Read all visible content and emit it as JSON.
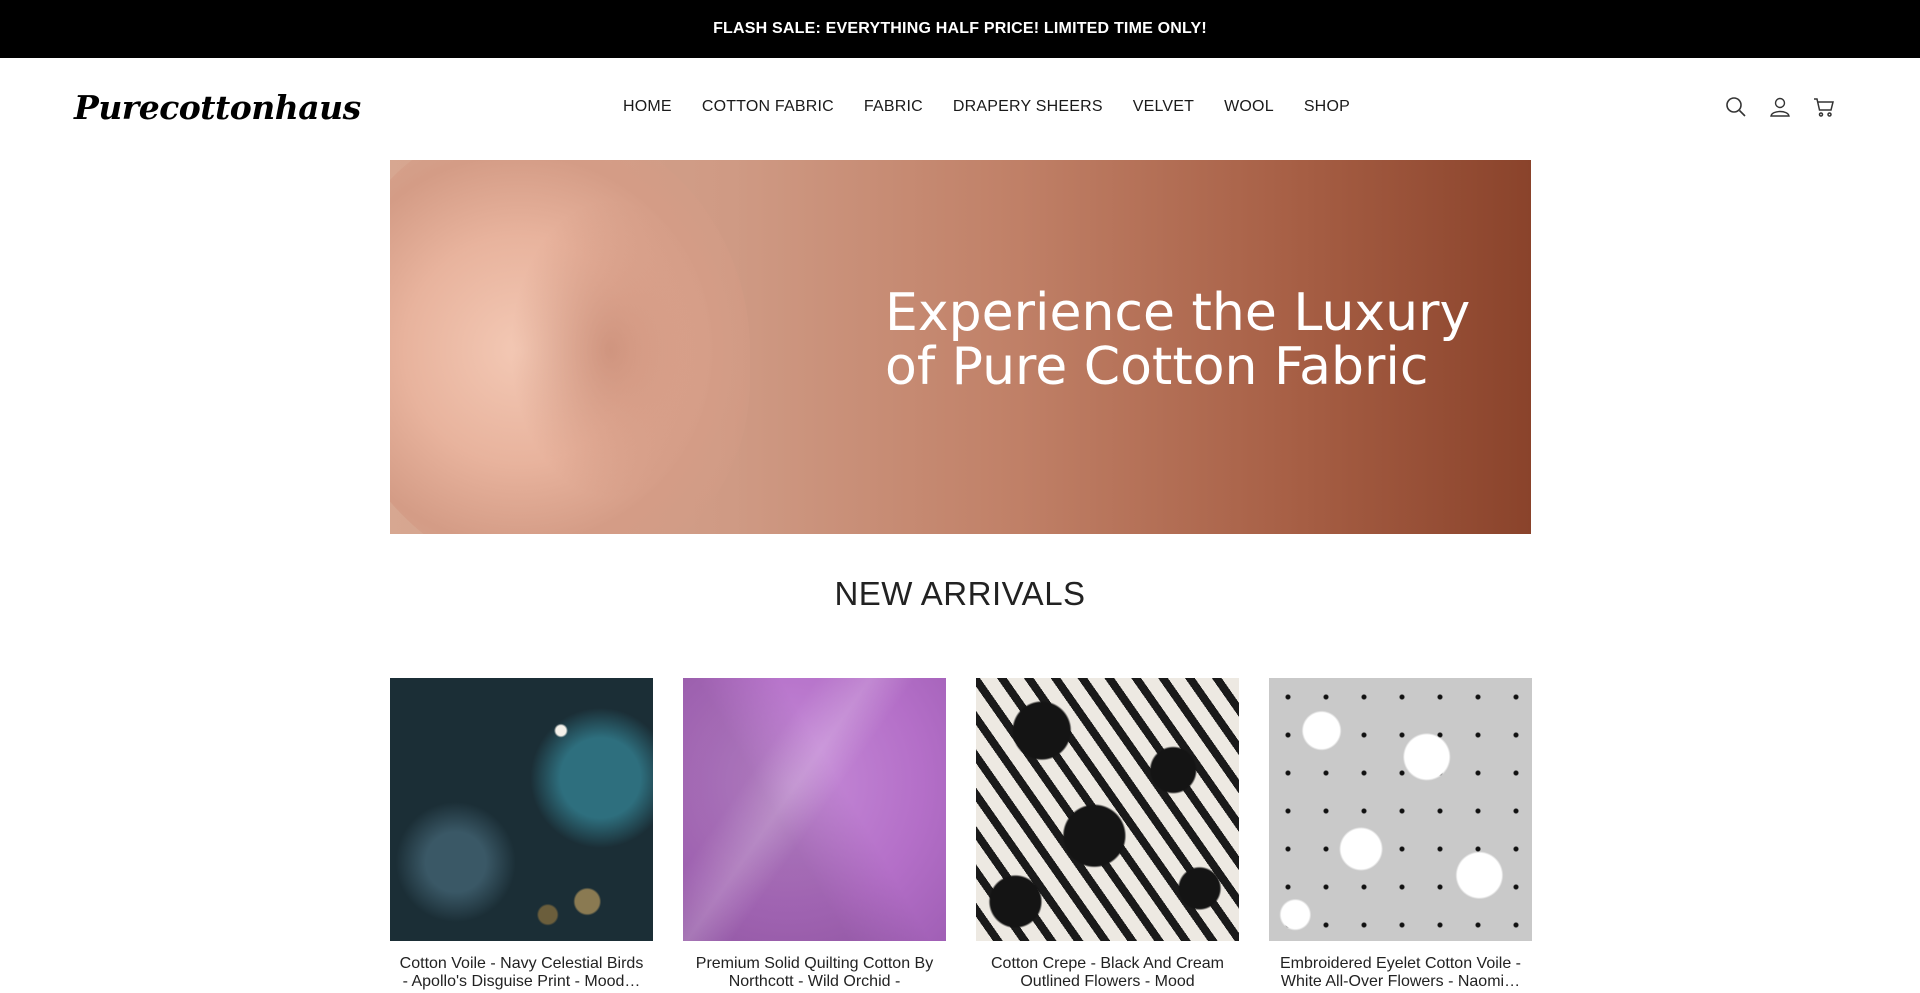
{
  "announcement": {
    "text": "FLASH SALE: EVERYTHING HALF PRICE! LIMITED TIME ONLY!"
  },
  "header": {
    "logo": "Purecottonhaus",
    "nav": [
      {
        "label": "HOME"
      },
      {
        "label": "COTTON FABRIC"
      },
      {
        "label": "FABRIC"
      },
      {
        "label": "DRAPERY SHEERS"
      },
      {
        "label": "VELVET"
      },
      {
        "label": "WOOL"
      },
      {
        "label": "SHOP"
      }
    ],
    "icons": [
      "search-icon",
      "account-icon",
      "cart-icon"
    ]
  },
  "hero": {
    "title": "Experience the Luxury of Pure Cotton Fabric"
  },
  "new_arrivals": {
    "title": "NEW ARRIVALS",
    "products": [
      {
        "name": "Cotton Voile - Navy Celestial Birds - Apollo's Disguise Print - Mood…"
      },
      {
        "name": "Premium Solid Quilting Cotton By Northcott - Wild Orchid - Colorwork…"
      },
      {
        "name": "Cotton Crepe - Black And Cream Outlined Flowers - Mood Exclusive…"
      },
      {
        "name": "Embroidered Eyelet Cotton Voile - White All-Over Flowers - Naomi…"
      }
    ]
  },
  "colors": {
    "announcement_bg": "#000000",
    "hero_dark": "#8a432b",
    "hero_light": "#d7a791"
  }
}
